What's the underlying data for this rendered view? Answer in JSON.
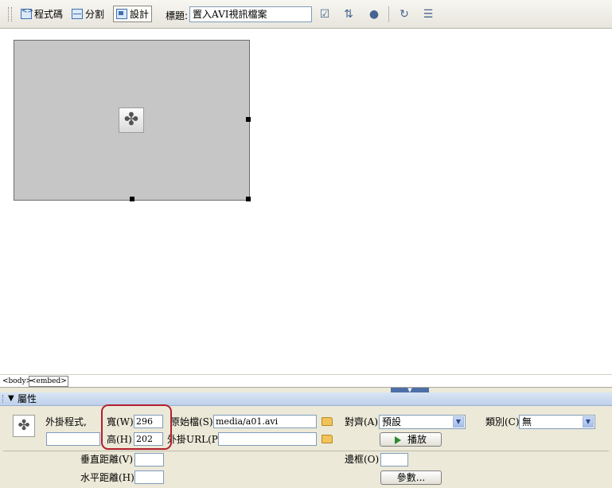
{
  "toolbar": {
    "code_view_label": "程式碼",
    "split_view_label": "分割",
    "design_view_label": "設計",
    "title_label": "標題:",
    "title_value": "置入AVI視訊檔案"
  },
  "tag_selector": [
    "<body>",
    "<embed>"
  ],
  "properties": {
    "panel_title": "屬性",
    "plugin_label": "外掛程式,",
    "plugin_name_value": "",
    "width_label": "寬(W)",
    "width_value": "296",
    "height_label": "高(H)",
    "height_value": "202",
    "src_label": "原始檔(S)",
    "src_value": "media/a01.avi",
    "plugin_url_label": "外掛URL(P)",
    "plugin_url_value": "",
    "align_label": "對齊(A)",
    "align_value": "預設",
    "class_label": "類別(C)",
    "class_value": "無",
    "play_button_label": "播放",
    "vspace_label": "垂直距離(V)",
    "vspace_value": "",
    "hspace_label": "水平距離(H)",
    "hspace_value": "",
    "border_label": "邊框(O)",
    "border_value": "",
    "params_button_label": "參數..."
  },
  "colors": {
    "embed_placeholder_bg": "#c6c6c6",
    "highlight_ring": "#b21f2d",
    "panel_bg": "#ece9d8"
  },
  "icons": [
    "code-view-icon",
    "split-view-icon",
    "design-view-icon",
    "file-management-icon",
    "preview-browser-icon",
    "refresh-icon",
    "view-options-icon",
    "plugin-icon",
    "folder-icon",
    "play-icon",
    "chevron-down-icon"
  ]
}
